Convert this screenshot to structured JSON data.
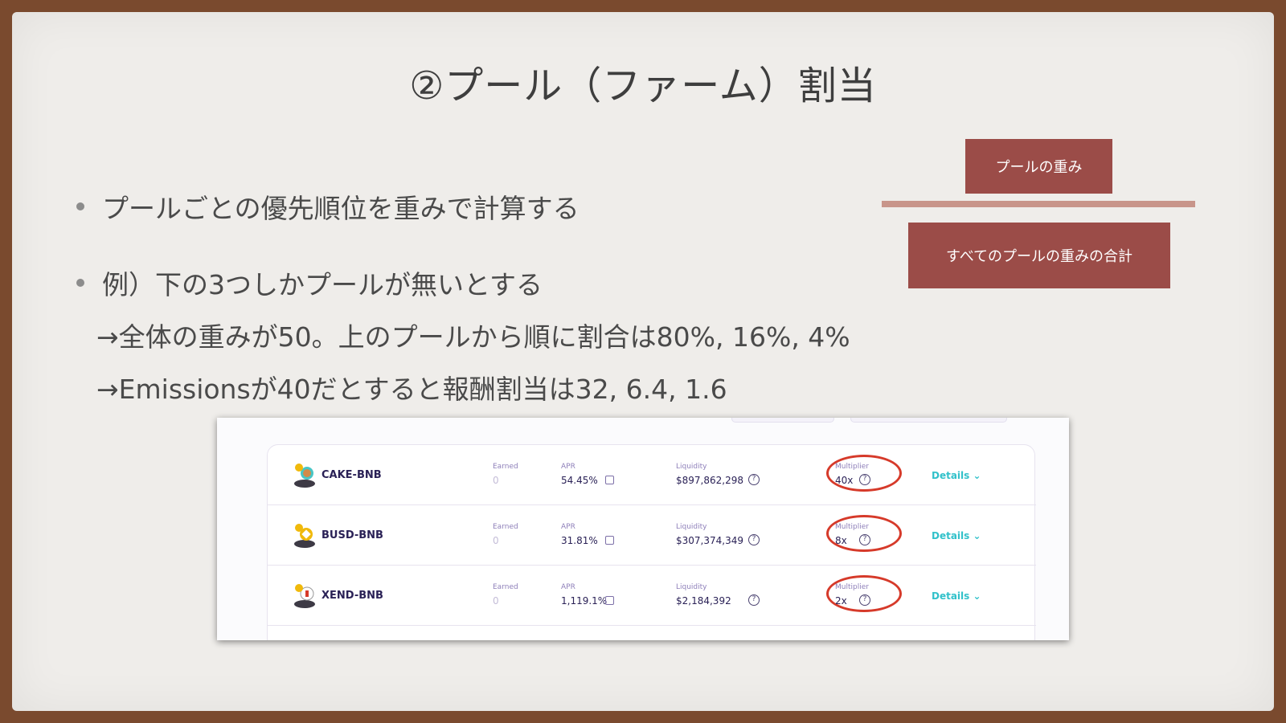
{
  "slide": {
    "title": "②プール（ファーム）割当",
    "bullets": [
      "プールごとの優先順位を重みで計算する",
      "例）下の3つしかプールが無いとする"
    ],
    "sub_lines": [
      "→全体の重みが50。上のプールから順に割合は80%, 16%, 4%",
      "→Emissionsが40だとすると報酬割当は32, 6.4, 1.6"
    ],
    "fraction": {
      "numerator": "プールの重み",
      "denominator": "すべてのプールの重みの合計"
    }
  },
  "colors": {
    "box": "#9b4c48",
    "ring": "#d63a2a",
    "details": "#31c1ca"
  },
  "farm_table": {
    "labels": {
      "earned": "Earned",
      "apr": "APR",
      "liquidity": "Liquidity",
      "multiplier": "Multiplier"
    },
    "rows": [
      {
        "pair": "CAKE-BNB",
        "earned": "0",
        "apr": "54.45%",
        "liquidity": "$897,862,298",
        "multiplier": "40x",
        "details": "Details ⌄",
        "icon": "cake-bnb-token-icon"
      },
      {
        "pair": "BUSD-BNB",
        "earned": "0",
        "apr": "31.81%",
        "liquidity": "$307,374,349",
        "multiplier": "8x",
        "details": "Details ⌄",
        "icon": "busd-bnb-token-icon"
      },
      {
        "pair": "XEND-BNB",
        "earned": "0",
        "apr": "1,119.1%",
        "liquidity": "$2,184,392",
        "multiplier": "2x",
        "details": "Details ⌄",
        "icon": "xend-bnb-token-icon"
      }
    ]
  }
}
